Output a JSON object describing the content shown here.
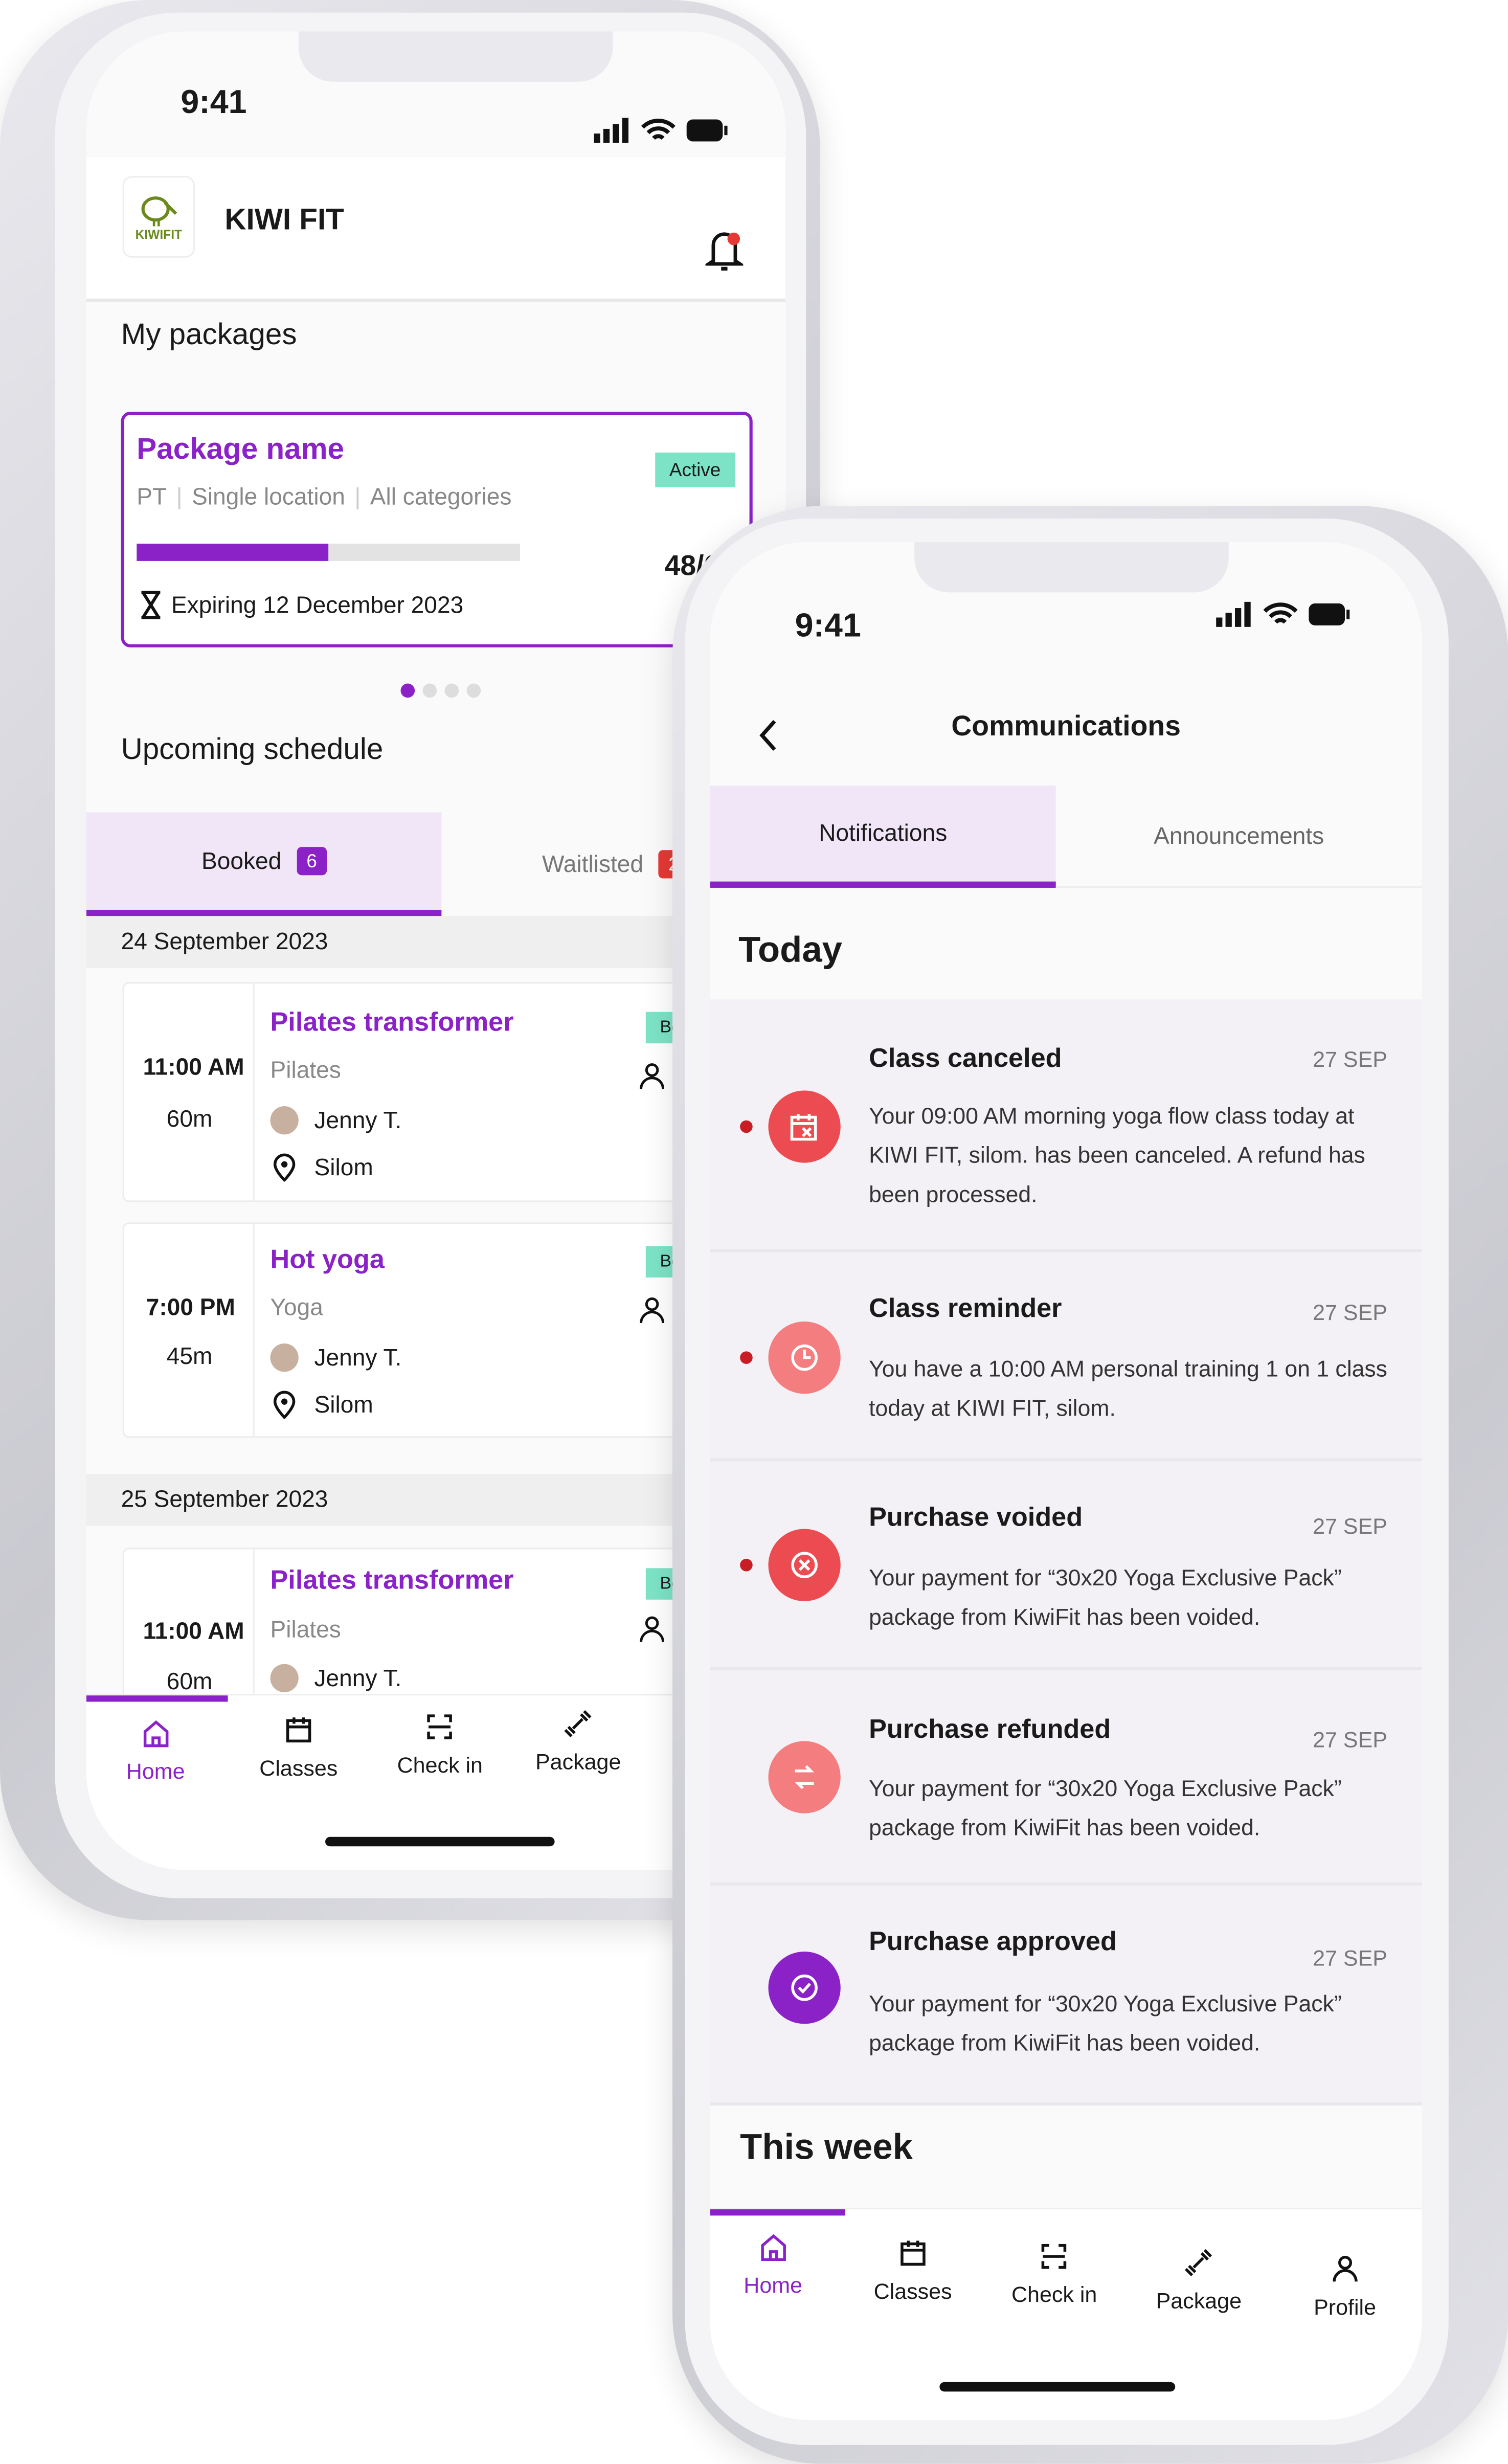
{
  "colors": {
    "accent": "#8a22c8",
    "active_badge": "#7de3c7",
    "cancel": "#ec4c51",
    "reminder": "#f47d7f",
    "approved": "#8a22c8",
    "unread_dot": "#c81d25"
  },
  "home": {
    "status_time": "9:41",
    "app_name": "KIWI FIT",
    "logo_text": "KIWIFIT",
    "section_packages": "My packages",
    "package": {
      "name": "Package name",
      "type": "PT",
      "location": "Single location",
      "categories": "All categories",
      "status": "Active",
      "usage": "48/6",
      "progress_percent": 50,
      "expiry": "Expiring 12 December 2023"
    },
    "carousel": {
      "pages": 4,
      "current": 1
    },
    "section_schedule": "Upcoming schedule",
    "tabs": [
      {
        "label": "Booked",
        "count": "6"
      },
      {
        "label": "Waitlisted",
        "count": "2"
      }
    ],
    "days": [
      {
        "date": "24 September 2023",
        "classes": [
          {
            "time": "11:00 AM",
            "duration": "60m",
            "title": "Pilates transformer",
            "category": "Pilates",
            "trainer": "Jenny T.",
            "location": "Silom",
            "badge": "Bo"
          },
          {
            "time": "7:00 PM",
            "duration": "45m",
            "title": "Hot yoga",
            "category": "Yoga",
            "trainer": "Jenny T.",
            "location": "Silom",
            "badge": "Bo"
          }
        ]
      },
      {
        "date": "25 September 2023",
        "classes": [
          {
            "time": "11:00 AM",
            "duration": "60m",
            "title": "Pilates transformer",
            "category": "Pilates",
            "trainer": "Jenny T.",
            "badge": "Bo"
          }
        ]
      }
    ],
    "nav": [
      "Home",
      "Classes",
      "Check in",
      "Package"
    ]
  },
  "comms": {
    "status_time": "9:41",
    "title": "Communications",
    "tabs": [
      "Notifications",
      "Announcements"
    ],
    "today": "Today",
    "this_week": "This week",
    "notifications": [
      {
        "title": "Class canceled",
        "date": "27 SEP",
        "body": "Your 09:00 AM morning yoga flow class today at KIWI FIT, silom. has been canceled. A refund has been processed.",
        "icon": "calendar-x-icon",
        "unread": true
      },
      {
        "title": "Class reminder",
        "date": "27 SEP",
        "body": "You have a 10:00 AM personal training 1 on 1 class today at KIWI FIT, silom.",
        "icon": "clock-check-icon",
        "unread": true
      },
      {
        "title": "Purchase voided",
        "date": "27 SEP",
        "body": "Your payment for “30x20 Yoga Exclusive Pack” package from KiwiFit has been voided.",
        "icon": "circle-x-icon",
        "unread": true
      },
      {
        "title": "Purchase refunded",
        "date": "27 SEP",
        "body": "Your payment for “30x20 Yoga Exclusive Pack” package from KiwiFit has been voided.",
        "icon": "refund-icon",
        "unread": false
      },
      {
        "title": "Purchase approved",
        "date": "27 SEP",
        "body": "Your payment for “30x20 Yoga Exclusive Pack” package from KiwiFit has been voided.",
        "icon": "circle-check-icon",
        "unread": false
      }
    ],
    "nav": [
      "Home",
      "Classes",
      "Check in",
      "Package",
      "Profile"
    ]
  }
}
